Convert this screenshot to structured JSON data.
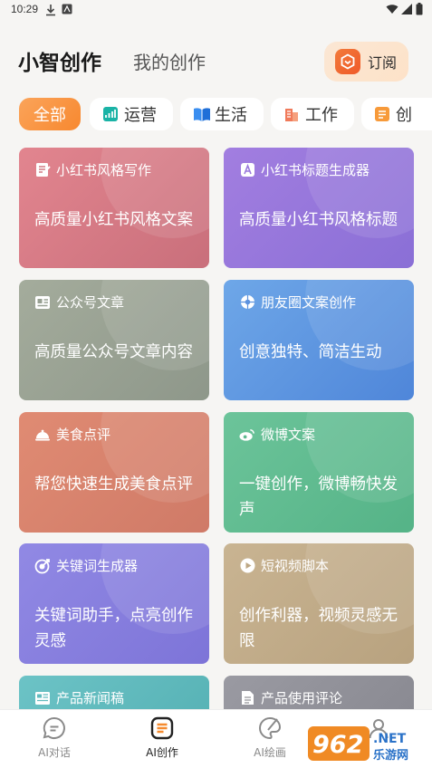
{
  "status_bar": {
    "time": "10:29"
  },
  "header": {
    "tab_main": "小智创作",
    "tab_mine": "我的创作",
    "subscribe_label": "订阅"
  },
  "categories": [
    {
      "label": "全部",
      "active": true
    },
    {
      "label": "运营",
      "icon": "chart-icon",
      "color": "#1ab3a6"
    },
    {
      "label": "生活",
      "icon": "book-icon",
      "color": "#3a8ef0"
    },
    {
      "label": "工作",
      "icon": "building-icon",
      "color": "#f07a5a"
    },
    {
      "label": "创",
      "icon": "doc-icon",
      "color": "#f79a3a"
    }
  ],
  "cards": [
    {
      "title": "小红书风格写作",
      "desc": "高质量小红书风格文案",
      "icon": "edit-doc-icon"
    },
    {
      "title": "小红书标题生成器",
      "desc": "高质量小红书风格标题",
      "icon": "letter-a-icon"
    },
    {
      "title": "公众号文章",
      "desc": "高质量公众号文章内容",
      "icon": "id-card-icon"
    },
    {
      "title": "朋友圈文案创作",
      "desc": "创意独特、简洁生动",
      "icon": "aperture-icon"
    },
    {
      "title": "美食点评",
      "desc": "帮您快速生成美食点评",
      "icon": "cloche-icon"
    },
    {
      "title": "微博文案",
      "desc": "一键创作，微博畅快发声",
      "icon": "weibo-icon"
    },
    {
      "title": "关键词生成器",
      "desc": "关键词助手，点亮创作灵感",
      "icon": "target-icon"
    },
    {
      "title": "短视频脚本",
      "desc": "创作利器，视频灵感无限",
      "icon": "play-icon"
    },
    {
      "title": "产品新闻稿",
      "desc": "",
      "icon": "news-icon"
    },
    {
      "title": "产品使用评论",
      "desc": "",
      "icon": "file-icon"
    }
  ],
  "bottom_nav": [
    {
      "label": "AI对话",
      "icon": "chat-icon",
      "active": false
    },
    {
      "label": "AI创作",
      "icon": "create-icon",
      "active": true
    },
    {
      "label": "AI绘画",
      "icon": "paint-icon",
      "active": false
    },
    {
      "label": "",
      "icon": "profile-icon",
      "active": false
    }
  ],
  "watermark": {
    "brand": "962.NET",
    "sub": "乐游网"
  }
}
